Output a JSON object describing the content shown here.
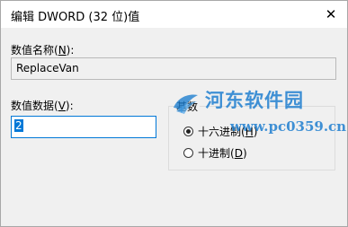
{
  "dialog": {
    "title": "编辑 DWORD (32 位)值",
    "close_glyph": "✕"
  },
  "value_name": {
    "label_pre": "数值名称(",
    "label_key": "N",
    "label_post": "):",
    "value": "ReplaceVan"
  },
  "value_data": {
    "label_pre": "数值数据(",
    "label_key": "V",
    "label_post": "):",
    "value": "2"
  },
  "base": {
    "title": "基数",
    "options": [
      {
        "label_pre": "十六进制(",
        "label_key": "H",
        "label_post": ")",
        "checked": true
      },
      {
        "label_pre": "十进制(",
        "label_key": "D",
        "label_post": ")",
        "checked": false
      }
    ]
  },
  "watermark": {
    "name": "河东软件园",
    "url": "www.pc0359.cn"
  }
}
